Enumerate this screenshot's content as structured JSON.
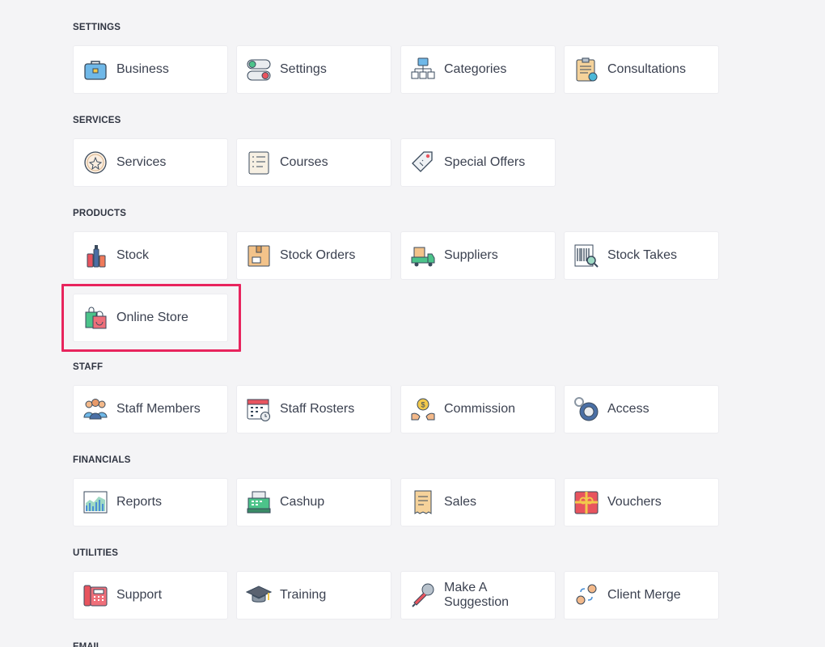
{
  "sections": [
    {
      "title": "SETTINGS",
      "items": [
        {
          "label": "Business",
          "icon": "briefcase-icon"
        },
        {
          "label": "Settings",
          "icon": "toggle-switches-icon"
        },
        {
          "label": "Categories",
          "icon": "hierarchy-icon"
        },
        {
          "label": "Consultations",
          "icon": "clipboard-icon"
        }
      ]
    },
    {
      "title": "SERVICES",
      "items": [
        {
          "label": "Services",
          "icon": "flower-badge-icon"
        },
        {
          "label": "Courses",
          "icon": "checklist-icon"
        },
        {
          "label": "Special Offers",
          "icon": "price-tag-icon"
        }
      ]
    },
    {
      "title": "PRODUCTS",
      "items": [
        {
          "label": "Stock",
          "icon": "cosmetics-bottles-icon"
        },
        {
          "label": "Stock Orders",
          "icon": "box-icon"
        },
        {
          "label": "Suppliers",
          "icon": "delivery-truck-icon"
        },
        {
          "label": "Stock Takes",
          "icon": "barcode-search-icon"
        },
        {
          "label": "Online Store",
          "icon": "shopping-bags-icon"
        }
      ]
    },
    {
      "title": "STAFF",
      "items": [
        {
          "label": "Staff Members",
          "icon": "team-icon"
        },
        {
          "label": "Staff Rosters",
          "icon": "calendar-clock-icon"
        },
        {
          "label": "Commission",
          "icon": "coin-hands-icon"
        },
        {
          "label": "Access",
          "icon": "key-lock-icon"
        }
      ]
    },
    {
      "title": "FINANCIALS",
      "items": [
        {
          "label": "Reports",
          "icon": "chart-icon"
        },
        {
          "label": "Cashup",
          "icon": "cash-register-icon"
        },
        {
          "label": "Sales",
          "icon": "receipt-icon"
        },
        {
          "label": "Vouchers",
          "icon": "gift-voucher-icon"
        }
      ]
    },
    {
      "title": "UTILITIES",
      "items": [
        {
          "label": "Support",
          "icon": "telephone-icon"
        },
        {
          "label": "Training",
          "icon": "graduation-cap-icon"
        },
        {
          "label": "Make A Suggestion",
          "icon": "microphone-icon"
        },
        {
          "label": "Client Merge",
          "icon": "merge-users-icon"
        }
      ]
    }
  ],
  "highlight_color": "#e8245d",
  "cutoff_title": "EMAIL"
}
